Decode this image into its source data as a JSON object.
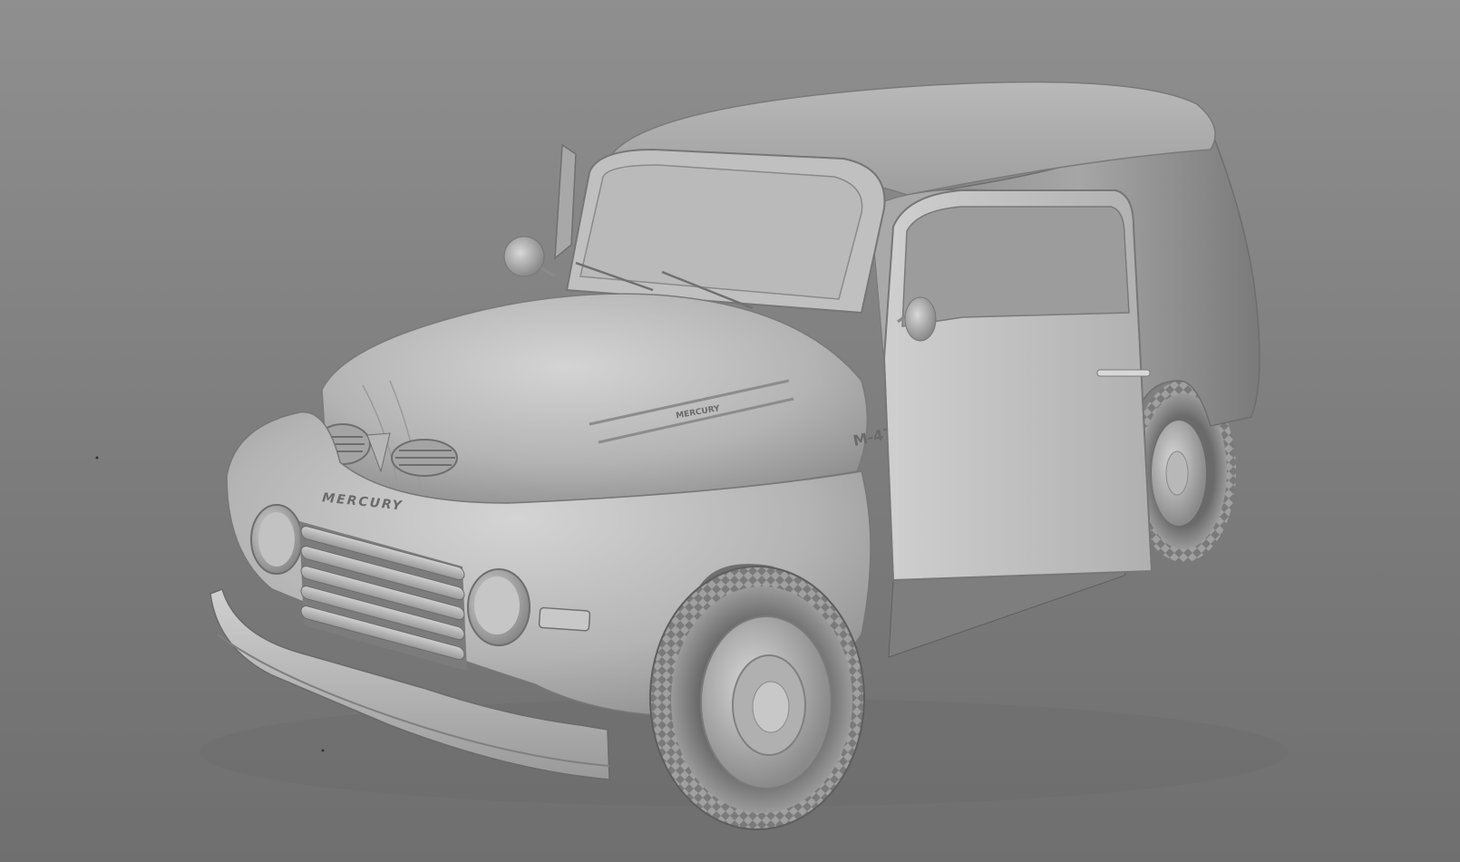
{
  "scene": {
    "background_color": "#858585",
    "body_color": "#bdbdbd",
    "shadow_color": "#5e5e5e",
    "highlight_color": "#dcdcdc"
  },
  "vehicle": {
    "grille_badge": "MERCURY",
    "hood_badge": "MERCURY",
    "fender_badge": "M-47"
  }
}
